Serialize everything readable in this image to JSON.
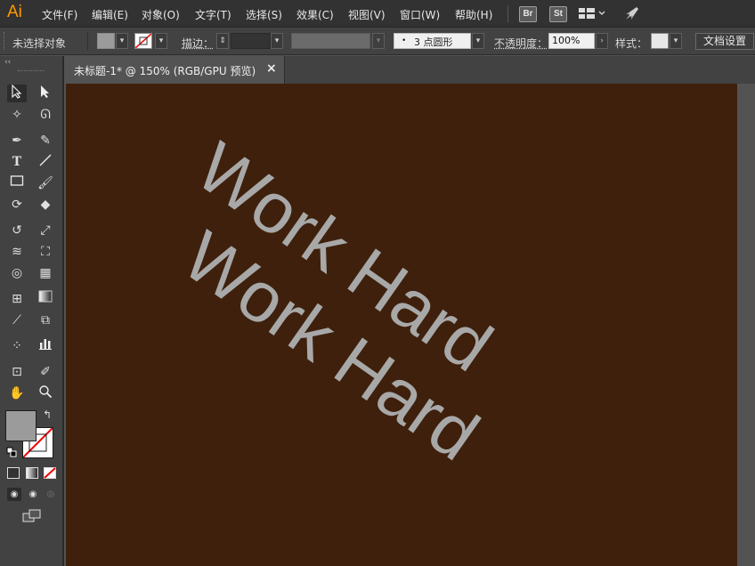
{
  "app": {
    "logo": "Ai"
  },
  "menu": [
    "文件(F)",
    "编辑(E)",
    "对象(O)",
    "文字(T)",
    "选择(S)",
    "效果(C)",
    "视图(V)",
    "窗口(W)",
    "帮助(H)"
  ],
  "bridge_buttons": [
    "Br",
    "St"
  ],
  "control_bar": {
    "selection_status": "未选择对象",
    "stroke_label": "描边：",
    "brush_value": "3 点圆形",
    "opacity_label": "不透明度：",
    "opacity_value": "100%",
    "style_label": "样式：",
    "doc_setup_label": "文档设置"
  },
  "document_tab": {
    "title": "未标题-1* @ 150% (RGB/GPU 预览)",
    "close_glyph": "×"
  },
  "artwork": {
    "text_1": "Work Hard",
    "text_2": "Work Hard"
  },
  "colors": {
    "canvas": "#3e200c",
    "text": "#a8a8a8",
    "fill_swatch": "#9b9b9b",
    "brand": "#ff9a00"
  }
}
